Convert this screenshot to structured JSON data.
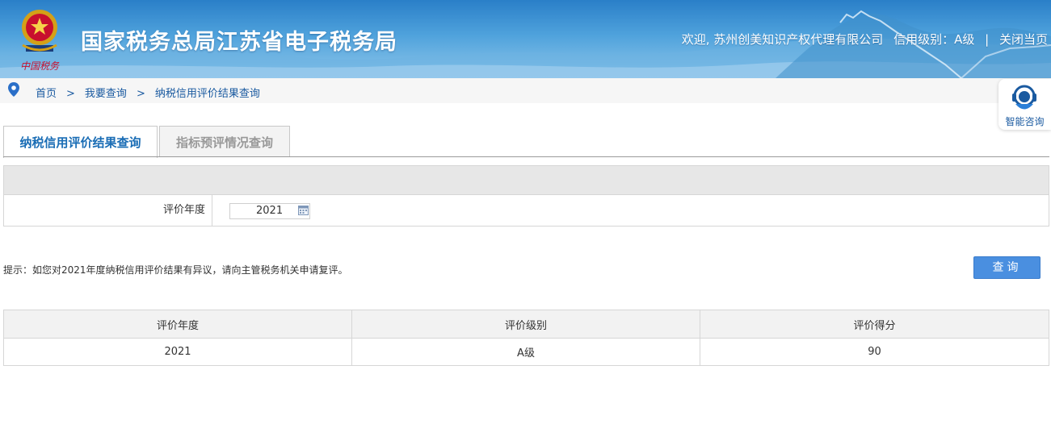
{
  "header": {
    "site_title": "国家税务总局江苏省电子税务局",
    "user_greeting": "欢迎, 苏州创美知识产权代理有限公司",
    "credit_level_text": "信用级别：A级",
    "separator": "|",
    "close_label": "关闭当页",
    "emblem_text": "中国税务",
    "accent_color": "#2a7fc8"
  },
  "breadcrumb": {
    "items": [
      "首页",
      "我要查询",
      "纳税信用评价结果查询"
    ],
    "arrow": ">"
  },
  "consult": {
    "label": "智能咨询"
  },
  "tabs": [
    {
      "label": "纳税信用评价结果查询",
      "active": true
    },
    {
      "label": "指标预评情况查询",
      "active": false
    }
  ],
  "form": {
    "year_label": "评价年度",
    "year_value": "2021"
  },
  "hint": "提示：如您对2021年度纳税信用评价结果有异议，请向主管税务机关申请复评。",
  "query_button": "查询",
  "result_table": {
    "headers": [
      "评价年度",
      "评价级别",
      "评价得分"
    ],
    "rows": [
      [
        "2021",
        "A级",
        "90"
      ]
    ]
  }
}
